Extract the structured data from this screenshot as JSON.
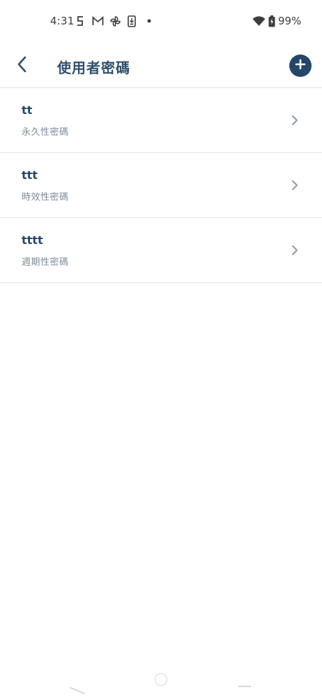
{
  "status_bar": {
    "time": "4:31",
    "battery_percent": "99%",
    "icons": [
      "sim-status-icon",
      "gmail-icon",
      "pinwheel-icon",
      "download-icon",
      "notification-dot-icon",
      "wifi-icon",
      "battery-icon"
    ]
  },
  "header": {
    "title": "使用者密碼",
    "back_icon": "back-arrow-icon",
    "add_icon": "plus-circle-icon"
  },
  "passwords": [
    {
      "name": "tt",
      "type": "永久性密碼"
    },
    {
      "name": "ttt",
      "type": "時效性密碼"
    },
    {
      "name": "tttt",
      "type": "週期性密碼"
    }
  ],
  "colors": {
    "accent": "#24466b",
    "title": "#2d4f6e",
    "subtitle": "#7d8b99",
    "divider": "#e4e4e4"
  }
}
